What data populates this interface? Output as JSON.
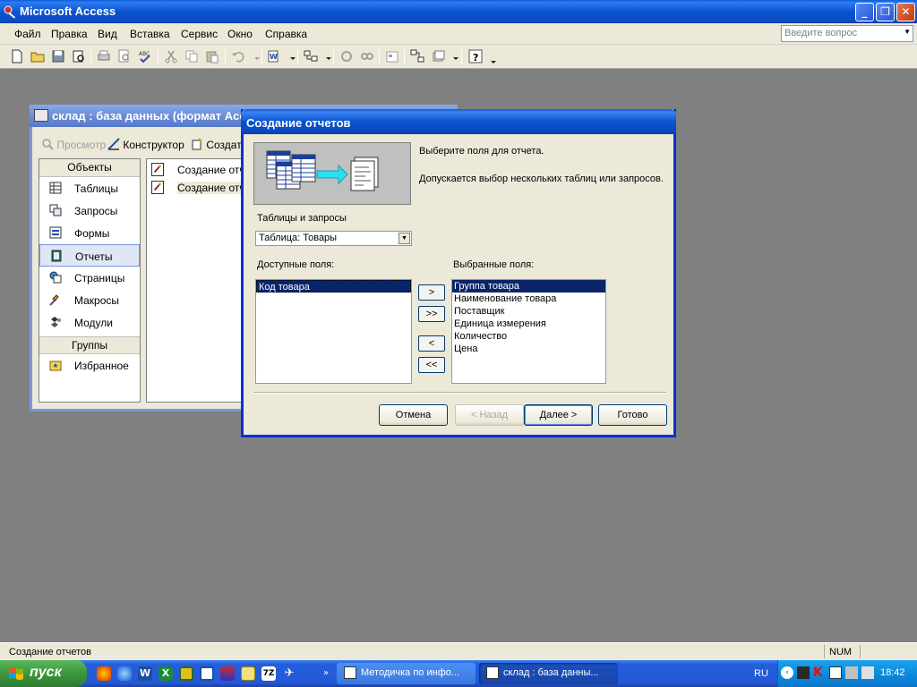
{
  "app": {
    "title": "Microsoft Access"
  },
  "menu": {
    "items": [
      "Файл",
      "Правка",
      "Вид",
      "Вставка",
      "Сервис",
      "Окно",
      "Справка"
    ],
    "ask_placeholder": "Введите вопрос"
  },
  "db_window": {
    "title": "склад : база данных (формат Access",
    "toolbar": {
      "preview": "Просмотр",
      "designer": "Конструктор",
      "create": "Создать"
    },
    "objects_header": "Объекты",
    "objects": [
      "Таблицы",
      "Запросы",
      "Формы",
      "Отчеты",
      "Страницы",
      "Макросы",
      "Модули"
    ],
    "groups_header": "Группы",
    "groups": [
      "Избранное"
    ],
    "list_items": [
      "Создание отче",
      "Создание отче"
    ]
  },
  "wizard": {
    "title": "Создание отчетов",
    "instruction": "Выберите поля для отчета.",
    "note": "Допускается выбор нескольких таблиц или запросов.",
    "tables_label": "Таблицы и запросы",
    "tables_value": "Таблица: Товары",
    "available_label": "Доступные поля:",
    "available_fields": [
      "Код товара"
    ],
    "selected_label": "Выбранные поля:",
    "selected_fields": [
      "Группа товара",
      "Наименование товара",
      "Поставщик",
      "Единица измерения",
      "Количество",
      "Цена"
    ],
    "move_buttons": [
      ">",
      ">>",
      "<",
      "<<"
    ],
    "buttons": {
      "cancel": "Отмена",
      "back": "< Назад",
      "next": "Далее >",
      "finish": "Готово"
    }
  },
  "status": {
    "text": "Создание отчетов",
    "num": "NUM"
  },
  "taskbar": {
    "start": "пуск",
    "tasks": [
      "Методичка по инфо...",
      "склад : база данны..."
    ],
    "lang": "RU",
    "clock": "18:42"
  }
}
